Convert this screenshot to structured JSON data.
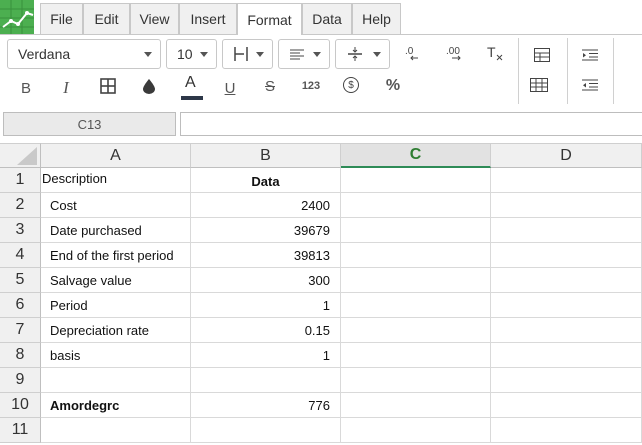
{
  "menu": {
    "tabs": [
      {
        "label": "File",
        "active": false
      },
      {
        "label": "Edit",
        "active": false
      },
      {
        "label": "View",
        "active": false
      },
      {
        "label": "Insert",
        "active": false
      },
      {
        "label": "Format",
        "active": true
      },
      {
        "label": "Data",
        "active": false
      },
      {
        "label": "Help",
        "active": false
      }
    ]
  },
  "toolbar": {
    "font_name": "Verdana",
    "font_size": "10",
    "row2": {
      "bold": "B",
      "italic": "I",
      "underline": "U",
      "strike": "S",
      "number_format": "123",
      "currency": "$",
      "percent": "%"
    },
    "text_color": "#2d3748",
    "icons": [
      "align-horizontal-icon",
      "align-text-icon",
      "vertical-align-icon",
      "decrease-decimal-icon",
      "increase-decimal-icon",
      "clear-format-icon",
      "insert-table-icon",
      "merge-cells-icon",
      "indent-icon",
      "outdent-icon",
      "borders-icon",
      "fill-color-icon",
      "text-color-icon",
      "currency-icon"
    ]
  },
  "formula_bar": {
    "cell_ref": "C13",
    "value": ""
  },
  "sheet": {
    "columns": [
      "A",
      "B",
      "C",
      "D"
    ],
    "selected_column": "C",
    "rows": [
      {
        "num": "1",
        "a": "Description",
        "b": "Data"
      },
      {
        "num": "2",
        "a": "Cost",
        "b": "2400"
      },
      {
        "num": "3",
        "a": "Date purchased",
        "b": "39679"
      },
      {
        "num": "4",
        "a": "End of the first period",
        "b": "39813"
      },
      {
        "num": "5",
        "a": "Salvage value",
        "b": "300"
      },
      {
        "num": "6",
        "a": "Period",
        "b": "1"
      },
      {
        "num": "7",
        "a": "Depreciation rate",
        "b": "0.15"
      },
      {
        "num": "8",
        "a": "basis",
        "b": "1"
      },
      {
        "num": "9",
        "a": "",
        "b": ""
      },
      {
        "num": "10",
        "a": "Amordegrc",
        "b": "776"
      },
      {
        "num": "11",
        "a": "",
        "b": ""
      }
    ]
  },
  "colors": {
    "accent_green": "#2e8b57",
    "logo_green": "#4caf50"
  }
}
